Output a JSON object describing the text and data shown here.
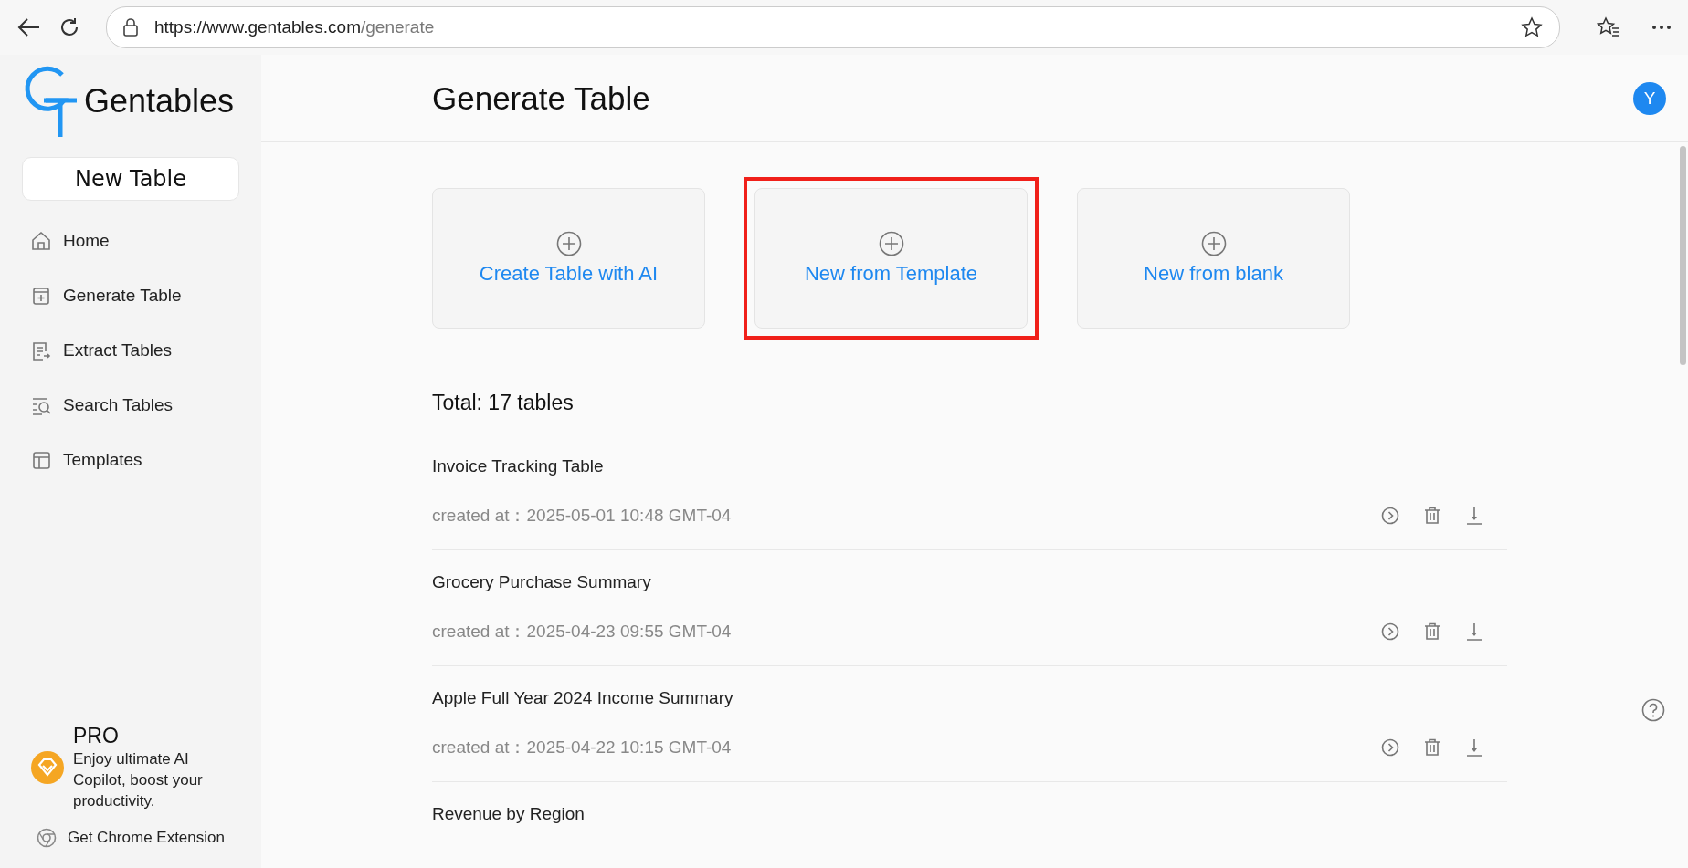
{
  "browser": {
    "url_host": "https://www.gentables.com",
    "url_path": "/generate"
  },
  "sidebar": {
    "logo_text": "Gentables",
    "new_button": "New Table",
    "items": [
      {
        "label": "Home"
      },
      {
        "label": "Generate Table"
      },
      {
        "label": "Extract Tables"
      },
      {
        "label": "Search Tables"
      },
      {
        "label": "Templates"
      }
    ],
    "promo": {
      "title": "PRO",
      "text": "Enjoy ultimate AI Copilot, boost your productivity."
    },
    "extension_link": "Get Chrome Extension"
  },
  "header": {
    "title": "Generate Table",
    "avatar": "Y"
  },
  "cards": [
    {
      "label": "Create Table with AI",
      "highlighted": false
    },
    {
      "label": "New from Template",
      "highlighted": true
    },
    {
      "label": "New from blank",
      "highlighted": false
    }
  ],
  "total": "Total: 17 tables",
  "tables": [
    {
      "name": "Invoice Tracking Table",
      "created_label": "created at：",
      "created": "2025-05-01 10:48 GMT-04"
    },
    {
      "name": "Grocery Purchase Summary",
      "created_label": "created at：",
      "created": "2025-04-23 09:55 GMT-04"
    },
    {
      "name": "Apple Full Year 2024 Income Summary",
      "created_label": "created at：",
      "created": "2025-04-22 10:15 GMT-04"
    },
    {
      "name": "Revenue by Region"
    }
  ]
}
